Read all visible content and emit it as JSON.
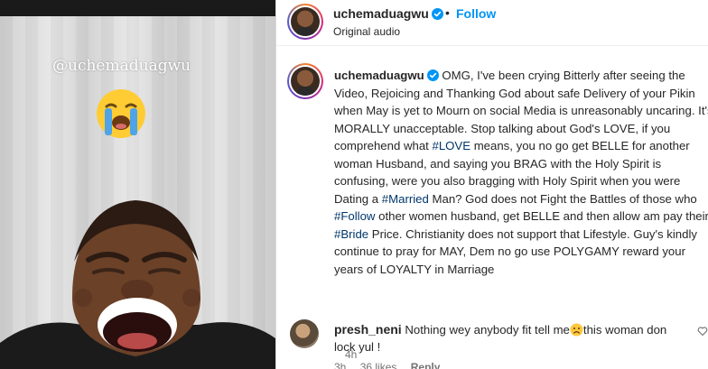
{
  "video": {
    "watermark": "@uchemaduagwu",
    "emoji": "loudly-crying-face-icon"
  },
  "header": {
    "username": "uchemaduagwu",
    "separator": "•",
    "follow_label": "Follow",
    "audio_label": "Original audio"
  },
  "caption": {
    "username": "uchemaduagwu",
    "parts": [
      {
        "text": "OMG, I've been crying Bitterly after seeing the Video, Rejoicing and Thanking God about safe Delivery of your Pikin when May is yet to Mourn on social Media is unreasonably uncaring. It's MORALLY unacceptable. Stop talking about God's LOVE, if you comprehend what "
      },
      {
        "tag": "#LOVE"
      },
      {
        "text": " means, you no go get BELLE for another woman Husband, and saying you BRAG with the Holy Spirit is confusing, were you also bragging with Holy Spirit when you were Dating a "
      },
      {
        "tag": "#Married"
      },
      {
        "text": " Man? God does not Fight the Battles of those who "
      },
      {
        "tag": "#Follow"
      },
      {
        "text": " other women husband, get BELLE and then allow am pay their "
      },
      {
        "tag": "#Bride"
      },
      {
        "text": " Price. Christianity does not support that Lifestyle. Guy's kindly continue to pray for MAY, Dem no go use POLYGAMY reward your years of LOYALTY in Marriage"
      }
    ],
    "time": "4h"
  },
  "comment": {
    "username": "presh_neni",
    "text_before": "Nothing wey anybody fit tell me",
    "emoji": "sad-face-icon",
    "text_after": "this woman don lock yul !",
    "time": "3h",
    "likes": "36 likes",
    "reply_label": "Reply"
  },
  "colors": {
    "link_blue": "#0095f6",
    "hashtag": "#00376b",
    "muted": "#737373",
    "verified": "#0095f6"
  }
}
